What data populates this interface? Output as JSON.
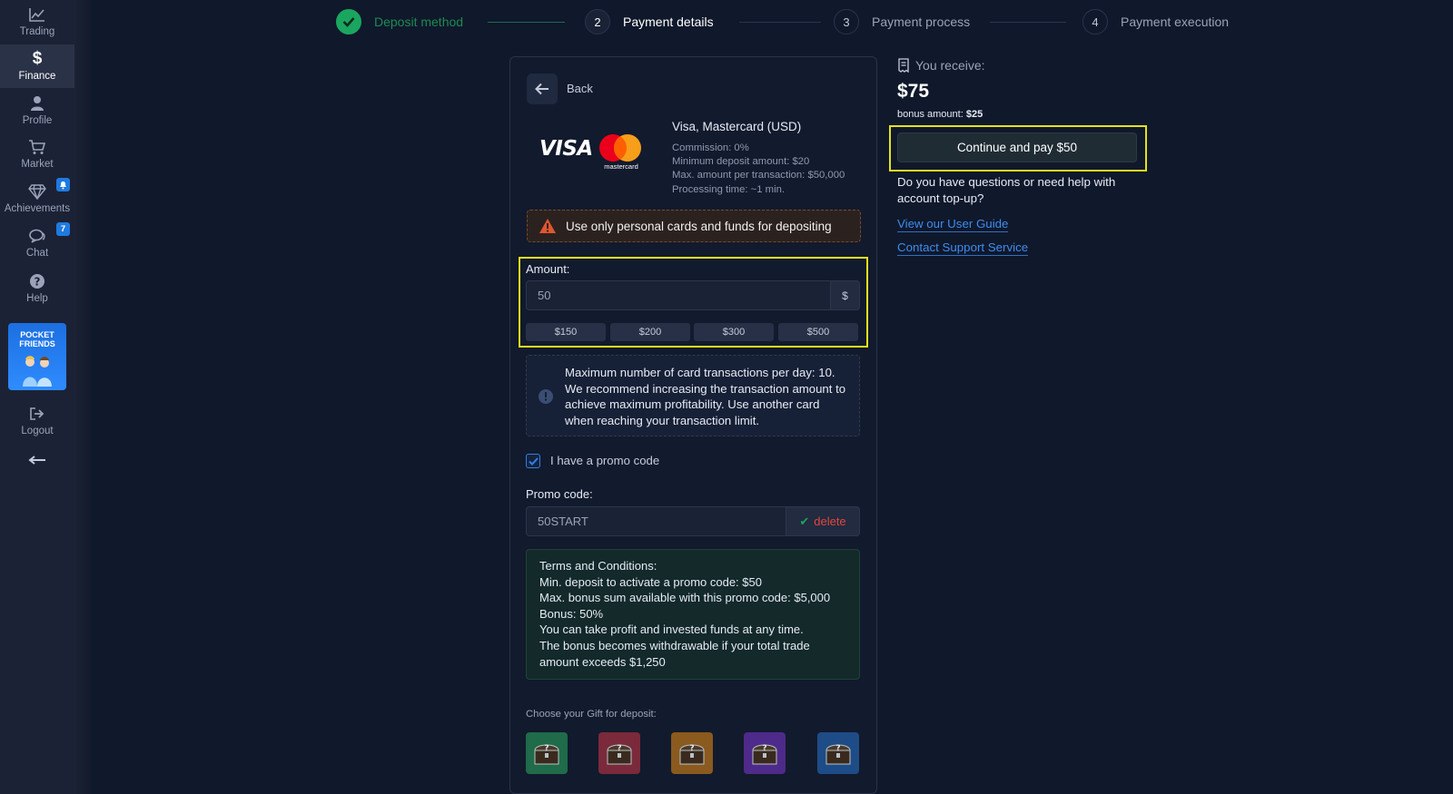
{
  "sidebar": {
    "items": [
      {
        "label": "Trading",
        "icon": "chart-line-icon"
      },
      {
        "label": "Finance",
        "icon": "dollar-icon"
      },
      {
        "label": "Profile",
        "icon": "user-icon"
      },
      {
        "label": "Market",
        "icon": "cart-icon"
      },
      {
        "label": "Achievements",
        "icon": "diamond-icon",
        "badge_icon": "bell-icon"
      },
      {
        "label": "Chat",
        "icon": "chat-icon",
        "badge": "7"
      },
      {
        "label": "Help",
        "icon": "question-icon"
      },
      {
        "label": "Logout",
        "icon": "logout-icon"
      }
    ],
    "active": "Finance",
    "banner": {
      "line1": "POCKET",
      "line2": "FRIENDS"
    },
    "collapse_icon": "arrow-left-icon"
  },
  "stepper": {
    "steps": [
      {
        "number": "",
        "label": "Deposit method",
        "state": "done"
      },
      {
        "number": "2",
        "label": "Payment details",
        "state": "current"
      },
      {
        "number": "3",
        "label": "Payment process",
        "state": "pending"
      },
      {
        "number": "4",
        "label": "Payment execution",
        "state": "pending"
      }
    ]
  },
  "card": {
    "back_label": "Back",
    "method": {
      "title": "Visa, Mastercard (USD)",
      "commission": "Commission: 0%",
      "min_deposit": "Minimum deposit amount: $20",
      "max_amount": "Max. amount per transaction: $50,000",
      "processing": "Processing time: ~1 min.",
      "visa_text": "VISA",
      "mc_text": "mastercard"
    },
    "warning": "Use only personal cards and funds for depositing",
    "amount": {
      "label": "Amount:",
      "value": "50",
      "currency": "$",
      "quick": [
        "$150",
        "$200",
        "$300",
        "$500"
      ]
    },
    "info": "Maximum number of card transactions per day: 10. We recommend increasing the transaction amount to achieve maximum profitability. Use another card when reaching your transaction limit.",
    "promo": {
      "checkbox_label": "I have a promo code",
      "checked": true,
      "label": "Promo code:",
      "value": "50START",
      "delete_label": "delete"
    },
    "terms": [
      "Terms and Conditions:",
      "Min. deposit to activate a promo code: $50",
      "Max. bonus sum available with this promo code: $5,000",
      "Bonus: 50%",
      "You can take profit and invested funds at any time.",
      "The bonus becomes withdrawable if your total trade",
      "amount exceeds $1,250"
    ],
    "gifts": {
      "label": "Choose your Gift for deposit:",
      "items": [
        {
          "name": "gift-chest-green",
          "color": "#1f6b4a"
        },
        {
          "name": "gift-chest-red",
          "color": "#7a2a3a"
        },
        {
          "name": "gift-chest-orange",
          "color": "#8a5a1e"
        },
        {
          "name": "gift-chest-purple",
          "color": "#4e2a8a"
        },
        {
          "name": "gift-chest-blue",
          "color": "#1e4c86"
        }
      ]
    }
  },
  "summary": {
    "receive_label": "You receive:",
    "receive_amount": "$75",
    "bonus_label": "bonus amount:",
    "bonus_value": "$25",
    "pay_button": "Continue and pay $50",
    "help_question": "Do you have questions or need help with account top-up?",
    "guide_link": "View our User Guide",
    "support_link": "Contact Support Service"
  },
  "colors": {
    "background": "#10182b",
    "accent_blue": "#3d8df0",
    "success_green": "#1aa65f",
    "delete_red": "#e2453d",
    "highlight_yellow": "#e4e21b"
  }
}
